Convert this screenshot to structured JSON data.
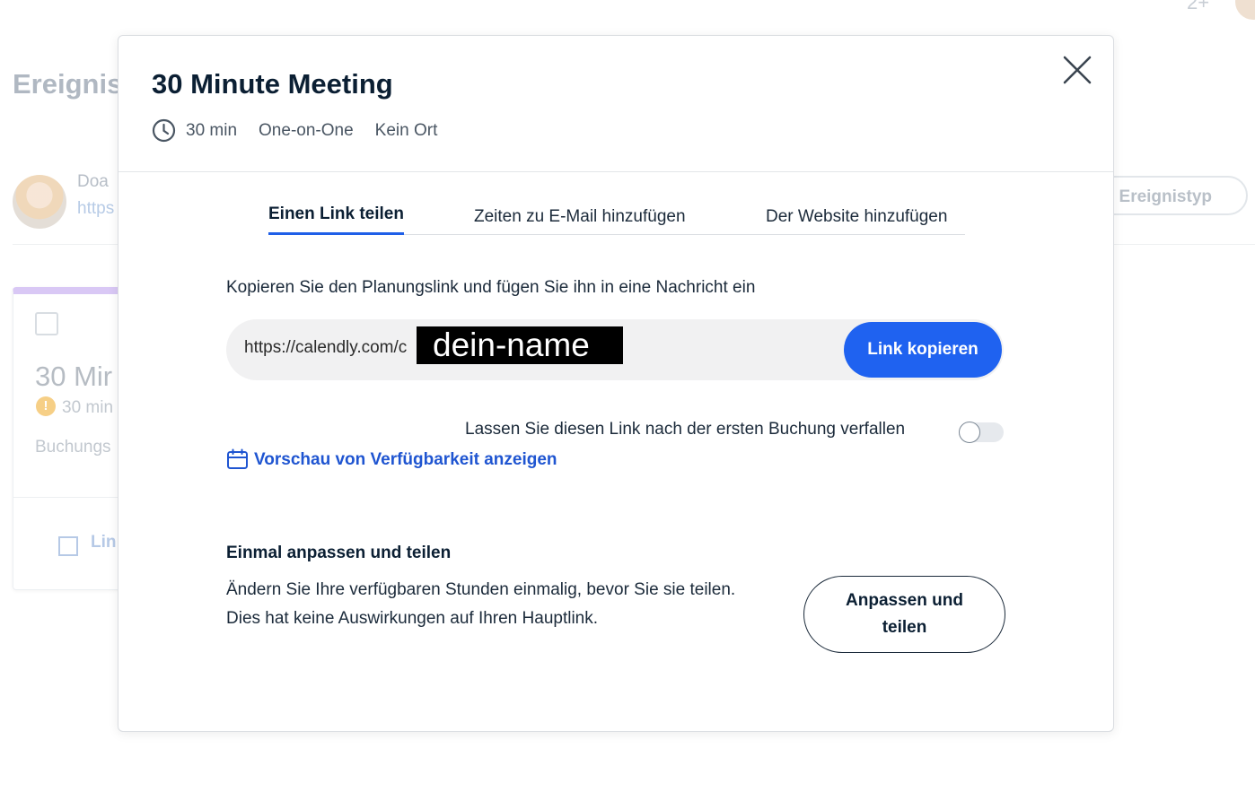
{
  "background": {
    "page_title": "Ereignis",
    "user_name": "Doa",
    "user_url": "https",
    "new_event_type_button": "uer Ereignistyp",
    "top_icon": "2+",
    "card": {
      "title": "30 Mir",
      "duration": "30 min",
      "booking": "Buchungs",
      "copy_link": "Lin"
    }
  },
  "modal": {
    "title": "30 Minute Meeting",
    "meta": {
      "duration": "30 min",
      "kind": "One-on-One",
      "location": "Kein Ort"
    },
    "tabs": [
      {
        "label": "Einen Link teilen",
        "active": true
      },
      {
        "label": "Zeiten zu E-Mail hinzufügen",
        "active": false
      },
      {
        "label": "Der Website hinzufügen",
        "active": false
      }
    ],
    "copy_instruction": "Kopieren Sie den Planungslink und fügen Sie ihn in eine Nachricht ein",
    "link": {
      "url": "https://calendly.com/c",
      "redacted_text": "dein-name",
      "copy_button": "Link kopieren"
    },
    "expire_toggle": {
      "label": "Lassen Sie diesen Link nach der ersten Buchung verfallen",
      "enabled": false
    },
    "preview_link": "Vorschau von Verfügbarkeit anzeigen",
    "customize": {
      "heading": "Einmal anpassen und teilen",
      "text": "Ändern Sie Ihre verfügbaren Stunden einmalig, bevor Sie sie teilen. Dies hat keine Auswirkungen auf Ihren Hauptlink.",
      "button": "Anpassen und teilen"
    }
  },
  "icons": [
    "clock-icon",
    "close-icon",
    "calendar-icon",
    "warning-icon",
    "copy-icon"
  ],
  "colors": {
    "accent": "#1f62f0",
    "link": "#1f55d1",
    "title": "#0b1f33",
    "card_accent": "#d9c8f5"
  }
}
